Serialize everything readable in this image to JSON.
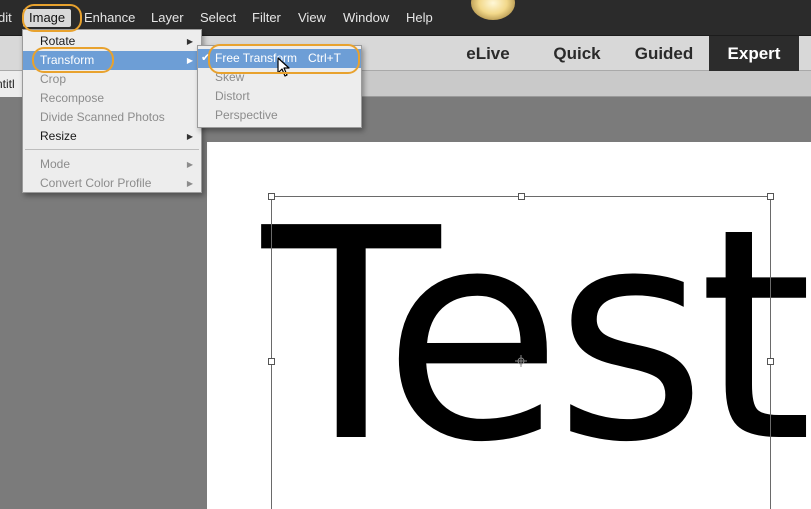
{
  "menubar": {
    "items": [
      "dit",
      "Image",
      "Enhance",
      "Layer",
      "Select",
      "Filter",
      "View",
      "Window",
      "Help"
    ],
    "active": "Image"
  },
  "modes": {
    "tabs": [
      "eLive",
      "Quick",
      "Guided",
      "Expert"
    ],
    "active": "Expert"
  },
  "document": {
    "tab_title": "ntitl"
  },
  "image_menu": {
    "items": [
      {
        "label": "Rotate",
        "enabled": true,
        "submenu": true
      },
      {
        "label": "Transform",
        "enabled": true,
        "submenu": true,
        "highlighted": true
      },
      {
        "label": "Crop",
        "enabled": false
      },
      {
        "label": "Recompose",
        "enabled": false
      },
      {
        "label": "Divide Scanned Photos",
        "enabled": false
      },
      {
        "label": "Resize",
        "enabled": true,
        "submenu": true
      },
      {
        "label": "Mode",
        "enabled": false,
        "submenu": true
      },
      {
        "label": "Convert Color Profile",
        "enabled": false,
        "submenu": true
      }
    ]
  },
  "transform_menu": {
    "items": [
      {
        "label": "Free Transform",
        "shortcut": "Ctrl+T",
        "checked": true,
        "highlighted": true
      },
      {
        "label": "Skew",
        "enabled": false
      },
      {
        "label": "Distort",
        "enabled": false
      },
      {
        "label": "Perspective",
        "enabled": false
      }
    ]
  },
  "canvas": {
    "text": "Test"
  },
  "icons": {
    "submenu_arrow": "triangle-right-icon",
    "check": "checkmark-icon",
    "cursor": "arrow-cursor-icon",
    "pivot": "crosshair-icon"
  },
  "colors": {
    "menubar_bg": "#2b2b2b",
    "highlight": "#6d9ed6",
    "callout": "#e8a22e",
    "active_mode_bg": "#2c2c2c"
  }
}
